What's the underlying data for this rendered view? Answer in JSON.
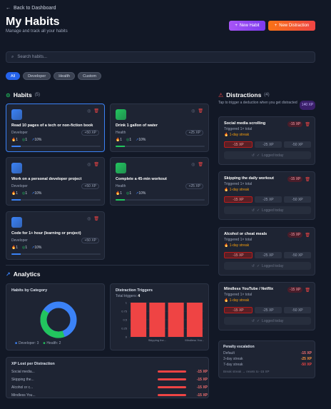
{
  "nav": {
    "back_label": "Back to Dashboard"
  },
  "header": {
    "title": "My Habits",
    "subtitle": "Manage and track all your habits",
    "new_habit_label": "New Habit",
    "new_distraction_label": "New Distraction"
  },
  "search": {
    "placeholder": "Search habits..."
  },
  "filters": [
    "All",
    "Developer",
    "Health",
    "Custom"
  ],
  "habits_section": {
    "title": "Habits",
    "count": "(5)"
  },
  "habits": [
    {
      "title": "Read 10 pages of a tech or non-fiction book",
      "category": "Developer",
      "xp": "+50 XP",
      "streak": "1",
      "done": "1",
      "pct": "10%",
      "progress": 0.1,
      "color": "#3b82f6"
    },
    {
      "title": "Drink 1 gallon of water",
      "category": "Health",
      "xp": "+25 XP",
      "streak": "1",
      "done": "1",
      "pct": "10%",
      "progress": 0.1,
      "color": "#22c55e"
    },
    {
      "title": "Work on a personal developer project",
      "category": "Developer",
      "xp": "+50 XP",
      "streak": "1",
      "done": "1",
      "pct": "10%",
      "progress": 0.1,
      "color": "#3b82f6"
    },
    {
      "title": "Complete a 45-min workout",
      "category": "Health",
      "xp": "+25 XP",
      "streak": "1",
      "done": "1",
      "pct": "10%",
      "progress": 0.1,
      "color": "#22c55e"
    },
    {
      "title": "Code for 1+ hour (learning or project)",
      "category": "Developer",
      "xp": "+50 XP",
      "streak": "1",
      "done": "1",
      "pct": "10%",
      "progress": 0.1,
      "color": "#3b82f6"
    }
  ],
  "distractions_section": {
    "title": "Distractions",
    "count": "(4)",
    "hint": "Tap to trigger a deduction when you get distracted",
    "xp_badge": "140 XP"
  },
  "distractions": [
    {
      "title": "Social media scrolling",
      "triggered": "Triggered 1× total",
      "streak": "1-day streak",
      "badge": "-15 XP",
      "options": [
        "-15 XP",
        "-25 XP",
        "-50 XP"
      ],
      "logged": "Logged today"
    },
    {
      "title": "Skipping the daily workout",
      "triggered": "Triggered 1× total",
      "streak": "1-day streak",
      "badge": "-15 XP",
      "options": [
        "-15 XP",
        "-25 XP",
        "-50 XP"
      ],
      "logged": "Logged today"
    },
    {
      "title": "Alcohol or cheat meals",
      "triggered": "Triggered 1× total",
      "streak": "1-day streak",
      "badge": "-15 XP",
      "options": [
        "-15 XP",
        "-25 XP",
        "-50 XP"
      ],
      "logged": "Logged today"
    },
    {
      "title": "Mindless YouTube / Netflix",
      "triggered": "Triggered 1× total",
      "streak": "1-day streak",
      "badge": "-15 XP",
      "options": [
        "-15 XP",
        "-25 XP",
        "-50 XP"
      ],
      "logged": "Logged today"
    }
  ],
  "penalty": {
    "title": "Penalty escalation",
    "rows": [
      {
        "label": "Default",
        "value": "-15 XP",
        "color": "#f87171"
      },
      {
        "label": "3-day streak",
        "value": "-25 XP",
        "color": "#fb923c"
      },
      {
        "label": "7-day streak",
        "value": "-50 XP",
        "color": "#ef4444"
      }
    ],
    "note": "Break streak → resets to -15 XP"
  },
  "analytics": {
    "title": "Analytics",
    "by_category_title": "Habits by Category",
    "legend": [
      {
        "label": "Developer: 3",
        "color": "#3b82f6",
        "value": 3
      },
      {
        "label": "Health: 2",
        "color": "#22c55e",
        "value": 2
      }
    ],
    "triggers_title": "Distraction Triggers",
    "triggers_total_label": "Total triggers:",
    "triggers_total": "4",
    "xp_lost_title": "XP Lost per Distraction",
    "xp_lost": [
      {
        "label": "Social media...",
        "value": "-15 XP"
      },
      {
        "label": "Skipping the...",
        "value": "-15 XP"
      },
      {
        "label": "Alcohol or c...",
        "value": "-15 XP"
      },
      {
        "label": "Mindless You...",
        "value": "-15 XP"
      }
    ]
  },
  "chart_data": {
    "type": "bar",
    "categories": [
      "Social media...",
      "Skipping the...",
      "Alcohol or c...",
      "Mindless You..."
    ],
    "x_tick_labels": [
      "Skipping the...",
      "Mindless You..."
    ],
    "values": [
      1,
      1,
      1,
      1
    ],
    "yticks": [
      "0",
      "0.25",
      "0.5",
      "0.75",
      "1"
    ],
    "ylim": [
      0,
      1
    ],
    "color": "#ef4444",
    "title": "Distraction Triggers"
  }
}
